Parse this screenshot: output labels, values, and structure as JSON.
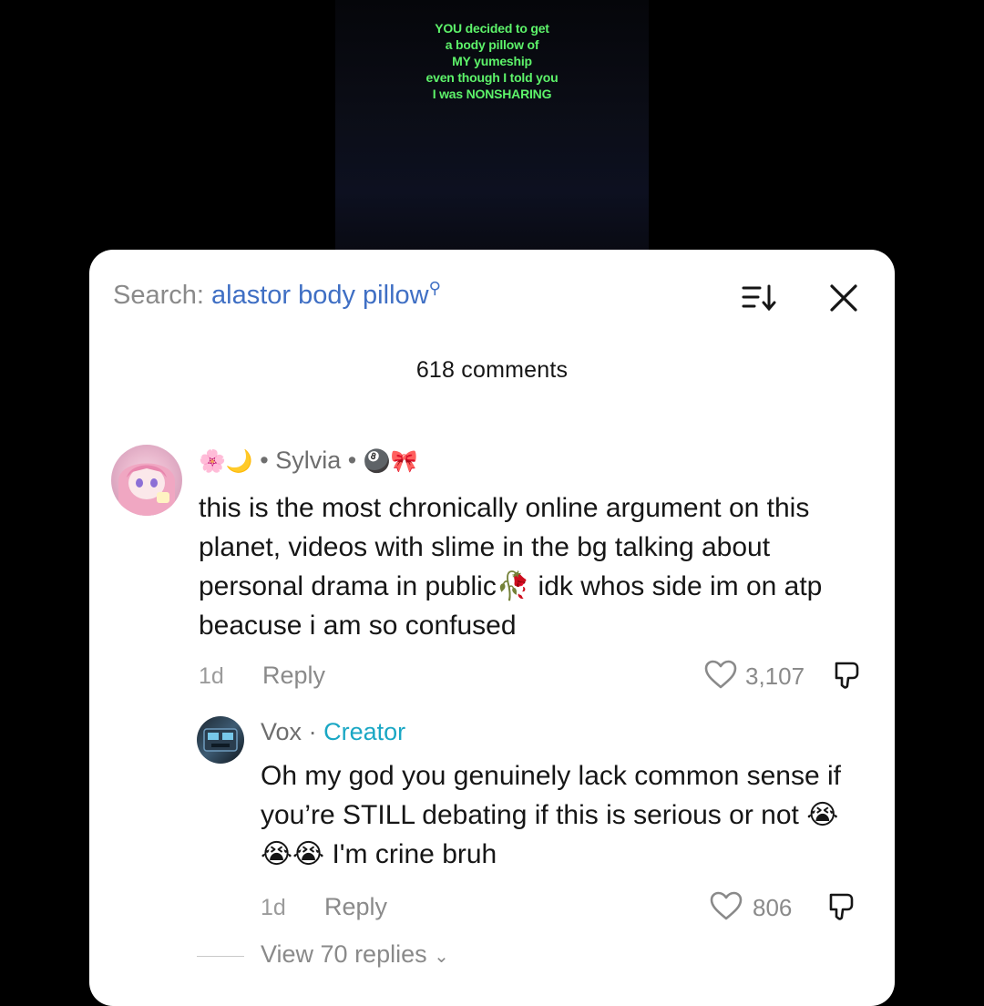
{
  "video": {
    "caption_lines": [
      "YOU decided to get",
      "a body pillow of",
      "MY yumeship",
      "even though I told you",
      "I was NONSHARING"
    ]
  },
  "panel": {
    "search_prefix": "Search:",
    "search_term": "alastor body pillow",
    "comment_count": "618 comments",
    "icons": {
      "sort": "sort-icon",
      "close": "close-icon",
      "search": "search-magnifier-icon"
    }
  },
  "comments": [
    {
      "author_prefix_emoji": "🌸🌙",
      "author_name": "Sylvia",
      "author_suffix_emoji": "🎱🎀",
      "text": "this is the most chronically online argument on this planet, videos with slime in the bg talking about personal drama in public🥀 idk whos side im on atp beacuse i am so confused",
      "age": "1d",
      "reply_label": "Reply",
      "likes": "3,107"
    },
    {
      "author_name": "Vox",
      "badge": "Creator",
      "text": "Oh my god you genuinely lack common sense if you’re STILL debating if this is serious or not 😭😭😭 I'm crine bruh",
      "age": "1d",
      "reply_label": "Reply",
      "likes": "806"
    }
  ],
  "view_replies": "View 70 replies",
  "colors": {
    "caption": "#5df36a",
    "search_term": "#3f6fc4",
    "creator_badge": "#1aa7c4"
  }
}
